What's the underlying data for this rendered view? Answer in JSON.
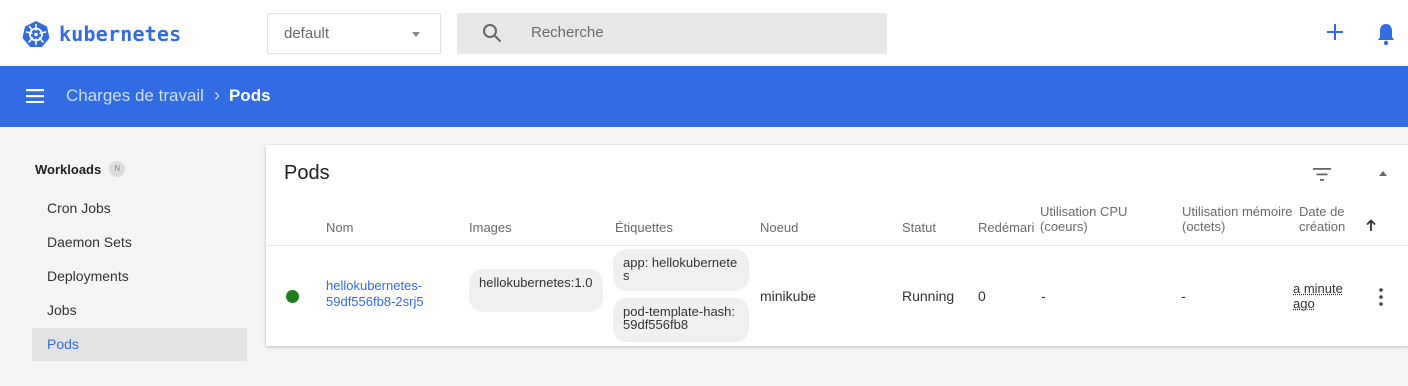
{
  "app": {
    "name": "kubernetes"
  },
  "namespace": {
    "selected": "default"
  },
  "search": {
    "placeholder": "Recherche"
  },
  "header": {
    "breadcrumb_parent": "Charges de travail",
    "breadcrumb_current": "Pods"
  },
  "sidebar": {
    "section_title": "Workloads",
    "section_badge": "N",
    "items": [
      {
        "label": "Cron Jobs"
      },
      {
        "label": "Daemon Sets"
      },
      {
        "label": "Deployments"
      },
      {
        "label": "Jobs"
      },
      {
        "label": "Pods",
        "active": true
      }
    ]
  },
  "card": {
    "title": "Pods",
    "columns": {
      "nom": "Nom",
      "images": "Images",
      "etiquettes": "Étiquettes",
      "noeud": "Noeud",
      "statut": "Statut",
      "redemarrages": "Redémari",
      "cpu": "Utilisation CPU (coeurs)",
      "memoire": "Utilisation mémoire (octets)",
      "date": "Date de création"
    },
    "rows": [
      {
        "name": "hellokubernetes-59df556fb8-2srj5",
        "image": "hellokubernetes:1.0",
        "label_1": "app: hellokubernetes",
        "label_2": "pod-template-hash: 59df556fb8",
        "node": "minikube",
        "status": "Running",
        "restarts": "0",
        "cpu": "-",
        "memory": "-",
        "age": "a minute ago"
      }
    ]
  },
  "colors": {
    "accent": "#326ce5",
    "running": "#1e7e1e"
  }
}
